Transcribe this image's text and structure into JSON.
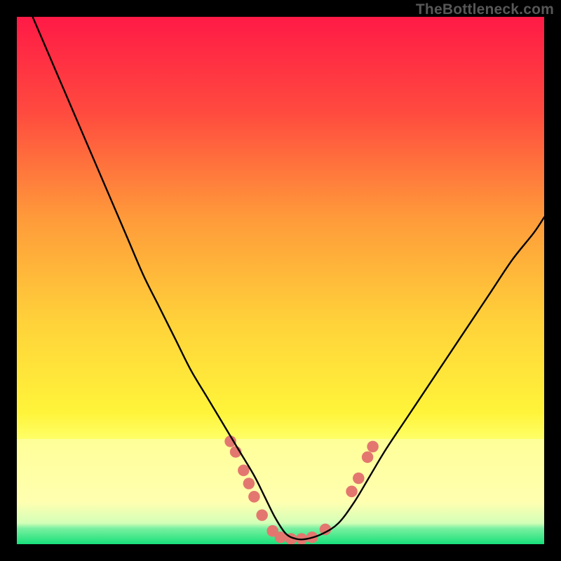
{
  "watermark": "TheBottleneck.com",
  "chart_data": {
    "type": "line",
    "title": "",
    "xlabel": "",
    "ylabel": "",
    "xlim": [
      0,
      100
    ],
    "ylim": [
      0,
      100
    ],
    "gradient_colors": {
      "top": "#ff1a46",
      "upper_mid": "#ff7a3a",
      "mid": "#ffd83a",
      "lower_mid": "#f7ff3a",
      "band": "#ffff99",
      "bottom": "#18e07a"
    },
    "series": [
      {
        "name": "bottleneck-curve",
        "color": "#000000",
        "x": [
          3,
          6,
          9,
          12,
          15,
          18,
          21,
          24,
          27,
          30,
          33,
          36,
          39,
          42,
          45,
          47,
          49,
          51,
          53,
          55,
          58,
          61,
          64,
          67,
          70,
          74,
          78,
          82,
          86,
          90,
          94,
          98,
          100
        ],
        "y": [
          100,
          93,
          86,
          79,
          72,
          65,
          58,
          51,
          45,
          39,
          33,
          28,
          23,
          18,
          13,
          9,
          5,
          2,
          1,
          1,
          2,
          4,
          8,
          13,
          18,
          24,
          30,
          36,
          42,
          48,
          54,
          59,
          62
        ]
      }
    ],
    "markers": {
      "name": "highlight-dots",
      "color": "#e3776f",
      "radius_pct": 1.1,
      "points": [
        {
          "x": 40.5,
          "y": 19.5
        },
        {
          "x": 41.5,
          "y": 17.5
        },
        {
          "x": 43.0,
          "y": 14.0
        },
        {
          "x": 44.0,
          "y": 11.5
        },
        {
          "x": 45.0,
          "y": 9.0
        },
        {
          "x": 46.5,
          "y": 5.5
        },
        {
          "x": 48.5,
          "y": 2.5
        },
        {
          "x": 50.0,
          "y": 1.3
        },
        {
          "x": 52.0,
          "y": 1.0
        },
        {
          "x": 54.0,
          "y": 1.0
        },
        {
          "x": 56.0,
          "y": 1.3
        },
        {
          "x": 58.5,
          "y": 2.8
        },
        {
          "x": 63.5,
          "y": 10.0
        },
        {
          "x": 64.8,
          "y": 12.5
        },
        {
          "x": 66.5,
          "y": 16.5
        },
        {
          "x": 67.5,
          "y": 18.5
        }
      ]
    }
  }
}
